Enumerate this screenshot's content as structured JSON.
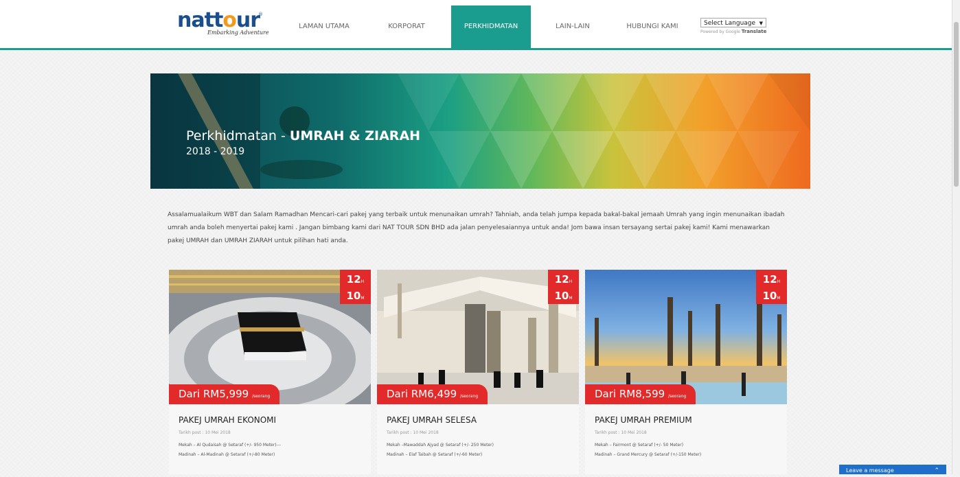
{
  "header": {
    "logo": {
      "text_a": "natt",
      "text_o": "o",
      "text_b": "ur",
      "tagline": "Embarking Adventure",
      "reg": "®"
    },
    "nav": [
      {
        "label": "LAMAN UTAMA",
        "active": false
      },
      {
        "label": "KORPORAT",
        "active": false
      },
      {
        "label": "PERKHIDMATAN",
        "active": true
      },
      {
        "label": "LAIN-LAIN",
        "active": false
      },
      {
        "label": "HUBUNGI KAMI",
        "active": false
      }
    ],
    "language": {
      "selected": "Select Language",
      "powered_prefix": "Powered by Google",
      "powered_brand": "Translate"
    }
  },
  "hero": {
    "title_prefix": "Perkhidmatan - ",
    "title_bold": "UMRAH & ZIARAH",
    "years": "2018 - 2019"
  },
  "intro": "Assalamualaikum WBT dan Salam Ramadhan Mencari-cari pakej yang terbaik untuk menunaikan umrah? Tahniah, anda telah jumpa kepada bakal-bakal jemaah Umrah  yang ingin menunaikan ibadah umrah anda boleh menyertai pakej kami . Jangan bimbang kami dari NAT TOUR SDN BHD ada jalan penyelesaiannya untuk anda! Jom bawa insan tersayang sertai pakej kami! Kami menawarkan pakej UMRAH dan UMRAH ZIARAH untuk pilihan hati anda.",
  "cards": [
    {
      "badge_top": "12",
      "badge_top_unit": "H",
      "badge_bottom": "10",
      "badge_bottom_unit": "M",
      "price": "Dari RM5,999",
      "price_note": "/seorang",
      "title": "PAKEJ UMRAH EKONOMI",
      "date": "Tarikh post : 10 Mei 2018",
      "line1": "Mekah – Al Qudaisah @ Setaraf (+/- 950 Meter)---",
      "line2": "Madinah – Al-Madinah @ Setaraf (+/-80 Meter)"
    },
    {
      "badge_top": "12",
      "badge_top_unit": "H",
      "badge_bottom": "10",
      "badge_bottom_unit": "M",
      "price": "Dari RM6,499",
      "price_note": "/seorang",
      "title": "PAKEJ UMRAH SELESA",
      "date": "Tarikh post : 10 Mei 2018",
      "line1": "Mekah –Mawaddah Ajyad @ Setaraf (+/- 250 Meter)",
      "line2": "Madinah – Elaf Taibah @ Setaraf (+/-60 Meter)"
    },
    {
      "badge_top": "12",
      "badge_top_unit": "H",
      "badge_bottom": "10",
      "badge_bottom_unit": "M",
      "price": "Dari RM8,599",
      "price_note": "/seorang",
      "title": "PAKEJ UMRAH PREMIUM",
      "date": "Tarikh post : 10 Mei 2018",
      "line1": "Mekah – Fairmont @ Setaraf (+/- 50 Meter)",
      "line2": "Madinah – Grand Mercury @ Setaraf (+/-150 Meter)"
    }
  ],
  "chat": {
    "label": "Leave a message"
  },
  "colors": {
    "teal": "#1a9d8e",
    "red": "#e32a2a",
    "blue": "#1b4f8c",
    "orange": "#f39a1e"
  }
}
